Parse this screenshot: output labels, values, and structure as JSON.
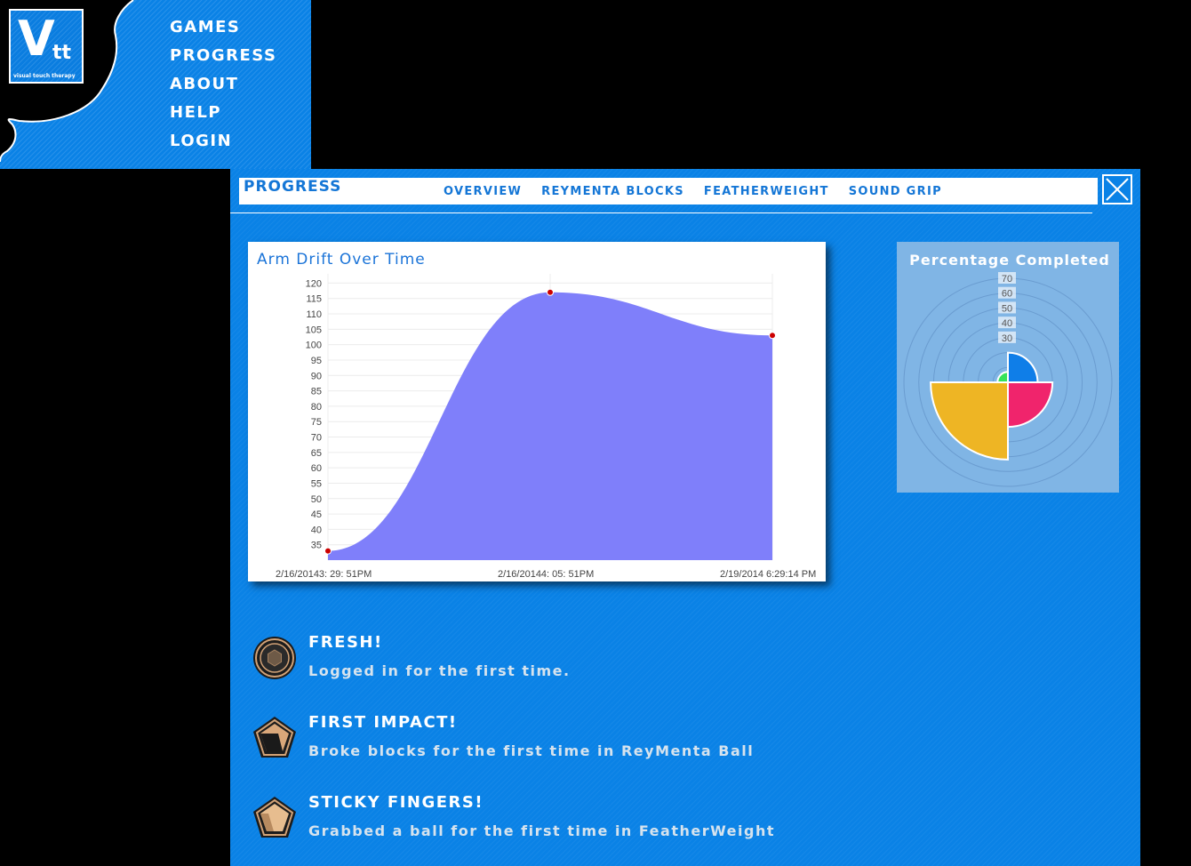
{
  "logo": {
    "mark_v": "V",
    "mark_tt": "tt",
    "tagline": "visual touch therapy"
  },
  "nav": {
    "items": [
      "GAMES",
      "PROGRESS",
      "ABOUT",
      "HELP",
      "LOGIN"
    ]
  },
  "page": {
    "title": "PROGRESS",
    "tabs": [
      "OVERVIEW",
      "REYMENTA BLOCKS",
      "FEATHERWEIGHT",
      "SOUND GRIP"
    ],
    "close_icon": "close-x-icon"
  },
  "arm_drift": {
    "title": "Arm Drift Over Time",
    "y_ticks": [
      35,
      40,
      45,
      50,
      55,
      60,
      65,
      70,
      75,
      80,
      85,
      90,
      95,
      100,
      105,
      110,
      115,
      120
    ],
    "x_labels": [
      "2/16/20143: 29: 51PM",
      "2/16/20144: 05: 51PM",
      "2/19/2014 6:29:14 PM"
    ],
    "chart_data": {
      "type": "area",
      "x": [
        "2/16/20143: 29: 51PM",
        "2/16/20144: 05: 51PM",
        "2/19/2014 6:29:14 PM"
      ],
      "values": [
        33,
        117,
        103
      ],
      "ylim": [
        30,
        123
      ],
      "color": "#7f7ffa",
      "point_color": "#cc0000",
      "grid": true
    }
  },
  "percentage_completed": {
    "title": "Percentage Completed",
    "r_ticks": [
      30,
      40,
      50,
      60,
      70
    ],
    "chart_data": {
      "type": "polar-area",
      "values": [
        20,
        30,
        52,
        7
      ],
      "colors": [
        "#0f7ee8",
        "#f0246c",
        "#eeb524",
        "#35e35b"
      ],
      "rmax": 70
    }
  },
  "achievements": [
    {
      "title": "FRESH!",
      "desc": "Logged in for the first time.",
      "icon": "fresh-badge-icon"
    },
    {
      "title": "FIRST IMPACT!",
      "desc": "Broke blocks for the first time in ReyMenta Ball",
      "icon": "first-impact-badge-icon"
    },
    {
      "title": "STICKY FINGERS!",
      "desc": "Grabbed a ball for the first time in FeatherWeight",
      "icon": "sticky-fingers-badge-icon"
    }
  ]
}
